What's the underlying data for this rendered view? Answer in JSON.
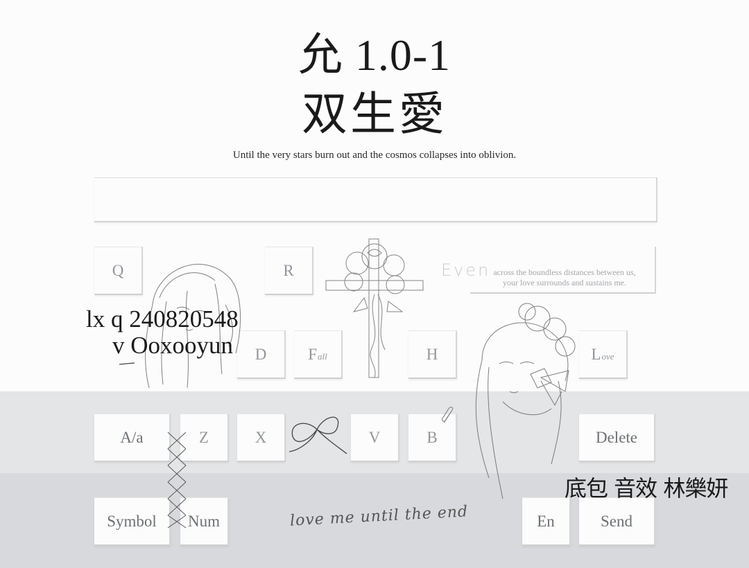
{
  "title": {
    "line1": "允 1.0-1",
    "line2": "双生愛",
    "subtitle": "Until the very stars burn out and the cosmos collapses into oblivion."
  },
  "input": {
    "value": ""
  },
  "keys": {
    "q": "Q",
    "r": "R",
    "d": "D",
    "f": "F",
    "f_small": "all",
    "h": "H",
    "l": "L",
    "l_small": "ove",
    "case": "A/a",
    "z": "Z",
    "x": "X",
    "v": "V",
    "b": "B",
    "delete": "Delete",
    "symbol": "Symbol",
    "num": "Num",
    "en": "En",
    "send": "Send"
  },
  "banner": {
    "word": "Even",
    "line1": "across the boundless distances between us,",
    "line2": "your love surrounds and sustains me."
  },
  "contact": {
    "line1": "lx q 240820548",
    "line2": "v Ooxooyun"
  },
  "credits": "底包 音效 林樂妍",
  "handwriting": "love me until the end",
  "colors": {
    "background": "#fcfcfc",
    "band_light": "#e4e5e7",
    "band_dark": "#d8d9dc",
    "text": "#1a1a1a",
    "key_text": "#94969b"
  }
}
